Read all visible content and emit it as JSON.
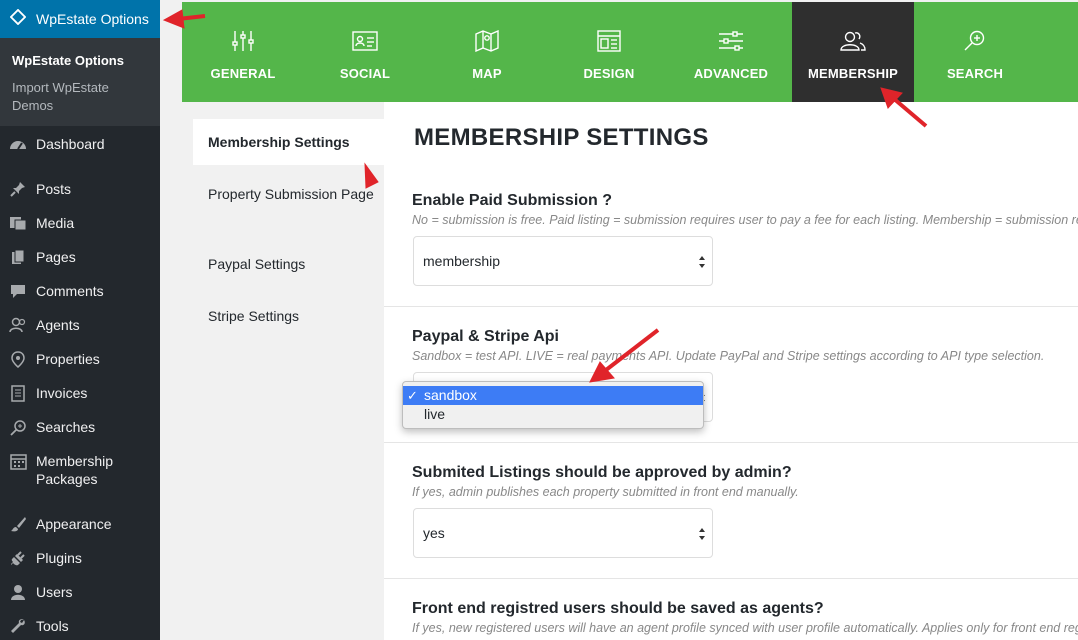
{
  "sidebar": {
    "active": {
      "label": "WpEstate Options",
      "icon": "diamond-icon"
    },
    "submenu": [
      {
        "label": "WpEstate Options",
        "current": true
      },
      {
        "label": "Import WpEstate Demos",
        "current": false
      }
    ],
    "items": [
      {
        "label": "Dashboard",
        "icon": "dashboard-icon"
      },
      {
        "label": "Posts",
        "icon": "pin-icon"
      },
      {
        "label": "Media",
        "icon": "media-icon"
      },
      {
        "label": "Pages",
        "icon": "pages-icon"
      },
      {
        "label": "Comments",
        "icon": "comment-icon"
      },
      {
        "label": "Agents",
        "icon": "agents-icon"
      },
      {
        "label": "Properties",
        "icon": "location-icon"
      },
      {
        "label": "Invoices",
        "icon": "invoice-icon"
      },
      {
        "label": "Searches",
        "icon": "search-icon"
      },
      {
        "label": "Membership Packages",
        "icon": "calendar-icon"
      },
      {
        "label": "Appearance",
        "icon": "brush-icon"
      },
      {
        "label": "Plugins",
        "icon": "plugin-icon"
      },
      {
        "label": "Users",
        "icon": "user-icon"
      },
      {
        "label": "Tools",
        "icon": "wrench-icon"
      }
    ]
  },
  "tabs": [
    {
      "label": "GENERAL",
      "icon": "sliders-icon"
    },
    {
      "label": "SOCIAL",
      "icon": "id-card-icon"
    },
    {
      "label": "MAP",
      "icon": "map-icon"
    },
    {
      "label": "DESIGN",
      "icon": "layout-icon"
    },
    {
      "label": "ADVANCED",
      "icon": "settings-lines-icon"
    },
    {
      "label": "MEMBERSHIP",
      "icon": "users-icon",
      "active": true
    },
    {
      "label": "SEARCH",
      "icon": "search-plus-icon"
    }
  ],
  "subtabs": [
    {
      "label": "Membership Settings",
      "active": true
    },
    {
      "label": "Property Submission Page"
    },
    {
      "label": "Paypal Settings"
    },
    {
      "label": "Stripe Settings"
    }
  ],
  "main": {
    "title": "MEMBERSHIP SETTINGS",
    "fields": [
      {
        "label": "Enable Paid Submission ?",
        "desc": "No = submission is free. Paid listing = submission requires user to pay a fee for each listing. Membership = submission requires user to buy a membership package.",
        "value": "membership"
      },
      {
        "label": "Paypal & Stripe Api",
        "desc": "Sandbox = test API. LIVE = real payments API. Update PayPal and Stripe settings according to API type selection.",
        "value": "sandbox",
        "options": [
          "sandbox",
          "live"
        ]
      },
      {
        "label": "Submited Listings should be approved by admin?",
        "desc": "If yes, admin publishes each property submitted in front end manually.",
        "value": "yes"
      },
      {
        "label": "Front end registred users should be saved as agents?",
        "desc": "If yes, new registered users will have an agent profile synced with user profile automatically. Applies only for front end registration."
      }
    ]
  },
  "colors": {
    "tabbar": "#54b64a",
    "tab_active": "#2f2f2f",
    "sidebar": "#23282d",
    "sidebar_active": "#0073aa",
    "selected_option": "#3d7cf5",
    "annotation": "#e0242a"
  }
}
